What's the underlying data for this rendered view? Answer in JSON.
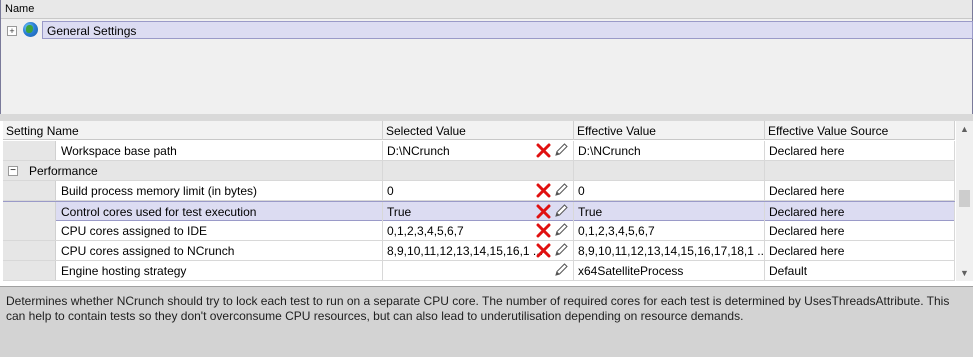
{
  "tree": {
    "header": "Name",
    "items": [
      {
        "label": "General Settings",
        "icon": "globe-icon",
        "expander": "+"
      }
    ]
  },
  "grid": {
    "columns": [
      "Setting Name",
      "Selected Value",
      "Effective Value",
      "Effective Value Source"
    ],
    "rows": [
      {
        "type": "setting",
        "name": "Workspace base path",
        "selected": "D:\\NCrunch",
        "effective": "D:\\NCrunch",
        "source": "Declared here",
        "resettable": true
      },
      {
        "type": "category",
        "name": "Performance",
        "expander": "−"
      },
      {
        "type": "setting",
        "name": "Build process memory limit (in bytes)",
        "selected": "0",
        "effective": "0",
        "source": "Declared here",
        "resettable": true
      },
      {
        "type": "setting",
        "name": "Control cores used for test execution",
        "selected": "True",
        "effective": "True",
        "source": "Declared here",
        "resettable": true,
        "selected_row": true
      },
      {
        "type": "setting",
        "name": "CPU cores assigned to IDE",
        "selected": "0,1,2,3,4,5,6,7",
        "effective": "0,1,2,3,4,5,6,7",
        "source": "Declared here",
        "resettable": true
      },
      {
        "type": "setting",
        "name": "CPU cores assigned to NCrunch",
        "selected": "8,9,10,11,12,13,14,15,16,1 ...",
        "effective": "8,9,10,11,12,13,14,15,16,17,18,1 ...",
        "source": "Declared here",
        "resettable": true
      },
      {
        "type": "setting",
        "name": "Engine hosting strategy",
        "selected": "",
        "effective": "x64SatelliteProcess",
        "source": "Default",
        "resettable": false
      }
    ]
  },
  "description": "Determines whether NCrunch should try to lock each test to run on a separate CPU core.  The number of required cores for each test is determined by UsesThreadsAttribute.  This can help to contain tests so they don't overconsume CPU resources, but can also lead to underutilisation depending on resource demands.",
  "scrollbar": {
    "up": "▲",
    "down": "▼"
  },
  "colors": {
    "selection": "#dcdcf2",
    "reset": "#e01010",
    "panel": "#d3d3d3"
  }
}
